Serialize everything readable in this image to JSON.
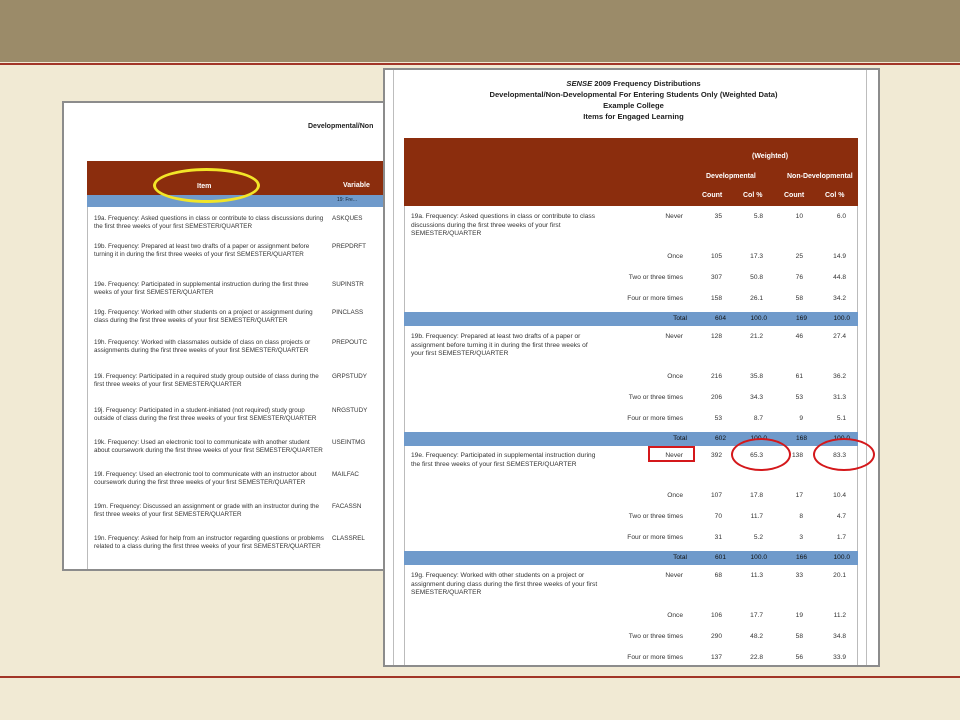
{
  "back_doc": {
    "subtitle": "Developmental/Non",
    "header_item": "Item",
    "header_variable": "Variable",
    "subheader": "19: Fre...",
    "rows": [
      {
        "item": "19a. Frequency: Asked questions in class or contribute to class discussions during the first three weeks of your first SEMESTER/QUARTER",
        "variable": "ASKQUES"
      },
      {
        "item": "19b. Frequency: Prepared at least two drafts of a paper or assignment before turning it in during the first three weeks of your first SEMESTER/QUARTER",
        "variable": "PREPDRFT"
      },
      {
        "item": "19e. Frequency: Participated in supplemental instruction during the first three weeks of your first SEMESTER/QUARTER",
        "variable": "SUPINSTR"
      },
      {
        "item": "19g. Frequency: Worked with other students on a project or assignment during class during the first three weeks of your first SEMESTER/QUARTER",
        "variable": "PINCLASS"
      },
      {
        "item": "19h. Frequency: Worked with classmates outside of class on class projects or assignments during the first three weeks of your first SEMESTER/QUARTER",
        "variable": "PREPOUTC"
      },
      {
        "item": "19i. Frequency: Participated in a required study group outside of class during the first three weeks of your first SEMESTER/QUARTER",
        "variable": "GRPSTUDY"
      },
      {
        "item": "19j. Frequency: Participated in a student-initiated (not required) study group outside of class during the first three weeks of your first SEMESTER/QUARTER",
        "variable": "NRGSTUDY"
      },
      {
        "item": "19k. Frequency: Used an electronic tool to communicate with another student about coursework during the first three weeks of your first SEMESTER/QUARTER",
        "variable": "USEINTMG"
      },
      {
        "item": "19l. Frequency: Used an electronic tool to communicate with an instructor about coursework during the first three weeks of your first SEMESTER/QUARTER",
        "variable": "MAILFAC"
      },
      {
        "item": "19m. Frequency: Discussed an assignment or grade with an instructor during the first three weeks of your first SEMESTER/QUARTER",
        "variable": "FACASSN"
      },
      {
        "item": "19n. Frequency: Asked for help from an instructor regarding questions or problems related to a class during the first three weeks of your first SEMESTER/QUARTER",
        "variable": "CLASSREL"
      }
    ]
  },
  "front_doc": {
    "title_prefix": "SENSE",
    "title_rest": " 2009 Frequency Distributions",
    "line2": "Developmental/Non-Developmental For Entering Students Only (Weighted Data)",
    "line3": "Example College",
    "line4": "Items for Engaged Learning",
    "header": {
      "weighted": "(Weighted)",
      "developmental": "Developmental",
      "non_developmental": "Non-Developmental",
      "count1": "Count",
      "colpct1": "Col %",
      "count2": "Count",
      "colpct2": "Col %"
    },
    "total_label": "Total",
    "questions": [
      {
        "text": "19a. Frequency: Asked questions in class or contribute to class discussions during the first three weeks of your first SEMESTER/QUARTER",
        "rows": [
          {
            "label": "Never",
            "c1": "35",
            "p1": "5.8",
            "c2": "10",
            "p2": "6.0"
          },
          {
            "label": "Once",
            "c1": "105",
            "p1": "17.3",
            "c2": "25",
            "p2": "14.9"
          },
          {
            "label": "Two or three times",
            "c1": "307",
            "p1": "50.8",
            "c2": "76",
            "p2": "44.8"
          },
          {
            "label": "Four or more times",
            "c1": "158",
            "p1": "26.1",
            "c2": "58",
            "p2": "34.2"
          }
        ],
        "total": {
          "c1": "604",
          "p1": "100.0",
          "c2": "169",
          "p2": "100.0"
        }
      },
      {
        "text": "19b. Frequency: Prepared at least two drafts of a paper or assignment before turning it in during the first three weeks of your first SEMESTER/QUARTER",
        "rows": [
          {
            "label": "Never",
            "c1": "128",
            "p1": "21.2",
            "c2": "46",
            "p2": "27.4"
          },
          {
            "label": "Once",
            "c1": "216",
            "p1": "35.8",
            "c2": "61",
            "p2": "36.2"
          },
          {
            "label": "Two or three times",
            "c1": "206",
            "p1": "34.3",
            "c2": "53",
            "p2": "31.3"
          },
          {
            "label": "Four or more times",
            "c1": "53",
            "p1": "8.7",
            "c2": "9",
            "p2": "5.1"
          }
        ],
        "total": {
          "c1": "602",
          "p1": "100.0",
          "c2": "168",
          "p2": "100.0"
        }
      },
      {
        "text": "19e. Frequency: Participated in supplemental instruction during the first three weeks of your first SEMESTER/QUARTER",
        "rows": [
          {
            "label": "Never",
            "c1": "392",
            "p1": "65.3",
            "c2": "138",
            "p2": "83.3"
          },
          {
            "label": "Once",
            "c1": "107",
            "p1": "17.8",
            "c2": "17",
            "p2": "10.4"
          },
          {
            "label": "Two or three times",
            "c1": "70",
            "p1": "11.7",
            "c2": "8",
            "p2": "4.7"
          },
          {
            "label": "Four or more times",
            "c1": "31",
            "p1": "5.2",
            "c2": "3",
            "p2": "1.7"
          }
        ],
        "total": {
          "c1": "601",
          "p1": "100.0",
          "c2": "166",
          "p2": "100.0"
        }
      },
      {
        "text": "19g. Frequency: Worked with other students on a project or assignment during class during the first three weeks of your first SEMESTER/QUARTER",
        "rows": [
          {
            "label": "Never",
            "c1": "68",
            "p1": "11.3",
            "c2": "33",
            "p2": "20.1"
          },
          {
            "label": "Once",
            "c1": "106",
            "p1": "17.7",
            "c2": "19",
            "p2": "11.2"
          },
          {
            "label": "Two or three times",
            "c1": "290",
            "p1": "48.2",
            "c2": "58",
            "p2": "34.8"
          },
          {
            "label": "Four or more times",
            "c1": "137",
            "p1": "22.8",
            "c2": "56",
            "p2": "33.9"
          }
        ]
      }
    ]
  },
  "colors": {
    "background": "#f1ead4",
    "top_bar": "#9b8b69",
    "accent_line": "#a23628",
    "table_header": "#8b2d0d",
    "total_bar": "#6f9acb",
    "highlight_red": "#d4181b",
    "highlight_yellow": "#f2e528"
  }
}
